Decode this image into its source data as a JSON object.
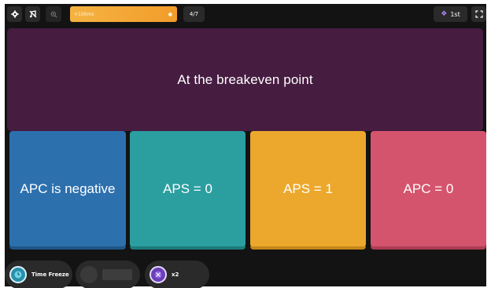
{
  "colors": {
    "app_bg": "#131313",
    "question_bg": "#461c41",
    "streak": "#f29c2a",
    "option_1": "#2d70ae",
    "option_2": "#2b9ea0",
    "option_3": "#eca82c",
    "option_4": "#d5546d"
  },
  "topbar": {
    "settings_icon": "gear-icon",
    "music_icon": "music-off-icon",
    "zoom_icon": "zoom-in-icon",
    "streak_text": "+100ms",
    "streak_icon": "flame-icon",
    "question_counter": "4/7",
    "rank_icon": "medal-icon",
    "rank": "1st",
    "fullscreen_icon": "fullscreen-icon"
  },
  "question": {
    "text": "At the breakeven point"
  },
  "options": [
    {
      "text": "APC is negative",
      "color": "#2d70ae"
    },
    {
      "text": "APS = 0",
      "color": "#2b9ea0"
    },
    {
      "text": "APS = 1",
      "color": "#eca82c"
    },
    {
      "text": "APC = 0",
      "color": "#d5546d"
    }
  ],
  "powerups": {
    "time_freeze": {
      "label": "Time Freeze",
      "icon": "clock-freeze-icon"
    },
    "empty_slot": {
      "label": ""
    },
    "multiplier": {
      "label": "x2",
      "icon": "multiplier-icon"
    }
  }
}
